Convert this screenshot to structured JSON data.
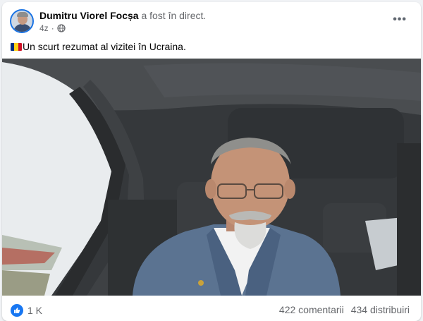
{
  "post": {
    "author": "Dumitru Viorel Focșa",
    "action": "a fost în direct.",
    "timestamp": "4z",
    "audience_icon": "globe-icon",
    "more_icon": "more-options-icon",
    "more_label": "•••",
    "text": "Un scurt rezumat al vizitei în Ucraina.",
    "text_prefix_icon": "romania-flag-icon",
    "flag_colors": [
      "#002b7f",
      "#fcd116",
      "#ce1126"
    ]
  },
  "footer": {
    "reaction_icon": "like-icon",
    "reaction_count": "1 K",
    "comments": "422 comentarii",
    "shares": "434 distribuiri"
  },
  "colors": {
    "brand_blue": "#1877f2",
    "secondary_text": "#65676b"
  }
}
